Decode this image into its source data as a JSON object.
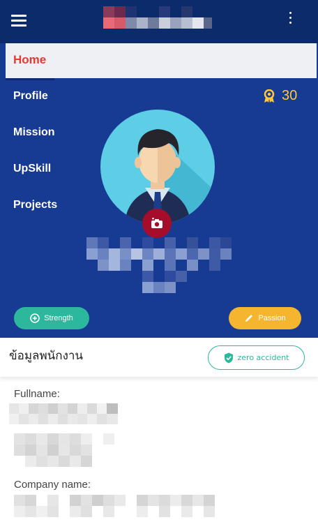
{
  "header": {
    "menu_icon": "hamburger-icon",
    "more_icon": "kebab-icon"
  },
  "sidebar": {
    "items": [
      {
        "label": "Home"
      },
      {
        "label": "Profile"
      },
      {
        "label": "Mission"
      },
      {
        "label": "UpSkill"
      },
      {
        "label": "Projects"
      }
    ]
  },
  "profile": {
    "points_icon": "badge-icon",
    "points": "30",
    "camera_icon": "camera-icon",
    "strength_label": "Strength",
    "passion_label": "Passion"
  },
  "info": {
    "title": "ข้อมูลพนักงาน",
    "zero_accident_label": "zero accident",
    "fullname_label": "Fullname:",
    "company_label": "Company name:"
  },
  "colors": {
    "topbar": "#0c2b6b",
    "hero": "#173a93",
    "accent_red": "#e53935",
    "teal": "#2cb89c",
    "gold": "#f5b52e",
    "points_gold": "#ffc838",
    "camera_red": "#a60d2b"
  }
}
